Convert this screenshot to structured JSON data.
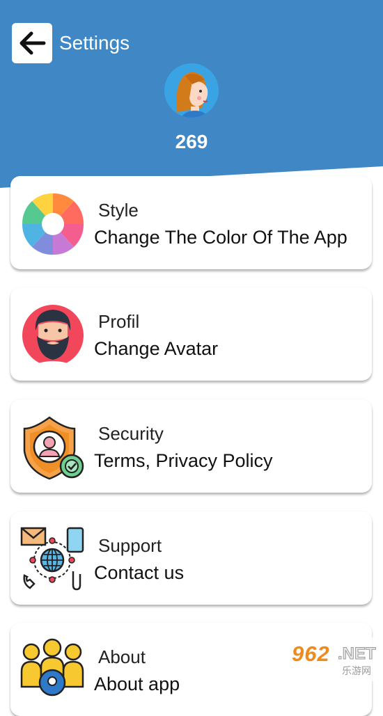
{
  "header": {
    "title": "Settings",
    "points": "269",
    "bg_color": "#3f88c5"
  },
  "items": [
    {
      "title": "Style",
      "subtitle": "Change The Color Of The App",
      "icon": "color-wheel-icon"
    },
    {
      "title": "Profil",
      "subtitle": "Change Avatar",
      "icon": "bearded-man-avatar-icon"
    },
    {
      "title": "Security",
      "subtitle": "Terms, Privacy Policy",
      "icon": "shield-user-icon"
    },
    {
      "title": "Support",
      "subtitle": "Contact us",
      "icon": "communication-globe-icon"
    },
    {
      "title": "About",
      "subtitle": "About app",
      "icon": "team-people-icon"
    }
  ],
  "watermark": {
    "brand": "962",
    "suffix": ".NET",
    "chinese": "乐游网"
  }
}
